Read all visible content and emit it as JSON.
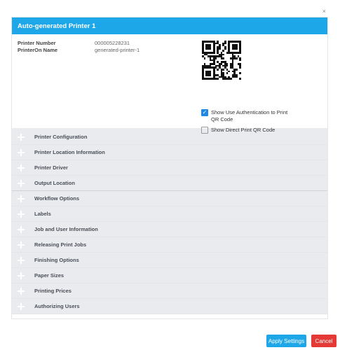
{
  "window": {
    "close_glyph": "×"
  },
  "dialog": {
    "title": "Auto-generated Printer 1",
    "printer_number_label": "Printer Number",
    "printer_number_value": "000005228231",
    "printeron_name_label": "PrinterOn Name",
    "printeron_name_value": "generated-printer-1",
    "qr_options": [
      {
        "label": "Show Use Authentication to Print QR Code",
        "checked": true
      },
      {
        "label": "Show Direct Print QR Code",
        "checked": false
      }
    ],
    "sections": [
      "Printer Configuration",
      "Printer Location Information",
      "Printer Driver",
      "Output Location",
      "Workflow Options",
      "Labels",
      "Job and User Information",
      "Releasing Print Jobs",
      "Finishing Options",
      "Paper Sizes",
      "Printing Prices",
      "Authorizing Users"
    ]
  },
  "footer": {
    "apply_label": "Apply Settings",
    "cancel_label": "Cancel"
  },
  "colors": {
    "title_bar": "#1ea7e8",
    "apply_button": "#1ea7e8",
    "cancel_button": "#e53935",
    "section_bg": "#e9ebef"
  }
}
